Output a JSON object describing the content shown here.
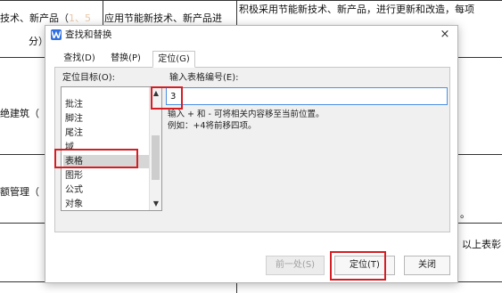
{
  "document": {
    "line1_left": "技术、新产品（",
    "line1_mark": "1、5",
    "line1_mid": "应用节能新技术、新产品进",
    "line1_right": "积极采用节能新技术、新产品，进行更新和改造，每项",
    "line2": "分）",
    "row2_label": "绝建筑（",
    "row3_label": "额管理（",
    "row3_right": "。",
    "row4_right": "以上表彰"
  },
  "dialog": {
    "title": "查找和替换",
    "close_glyph": "×",
    "tabs": [
      {
        "label": "查找(D)",
        "active": false
      },
      {
        "label": "替换(P)",
        "active": false
      },
      {
        "label": "定位(G)",
        "active": true
      }
    ],
    "target_label": "定位目标(O):",
    "target_items": [
      "批注",
      "脚注",
      "尾注",
      "域",
      "表格",
      "图形",
      "公式",
      "对象"
    ],
    "selected_target": "表格",
    "input_label": "输入表格编号(E):",
    "input_value": "3",
    "hint_line1": "输入 + 和 - 可将相关内容移至当前位置。",
    "hint_line2": "例如：+4将前移四项。",
    "buttons": {
      "prev": "前一处(S)",
      "goto": "定位(T)",
      "close": "关闭"
    },
    "colors": {
      "accent": "#2f6fe0",
      "highlight_box": "#d51e24",
      "input_border": "#4a90e2"
    }
  }
}
